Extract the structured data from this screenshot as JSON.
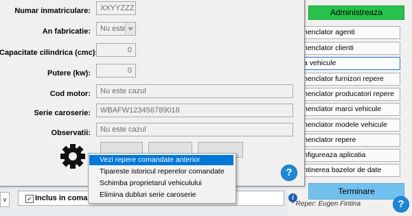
{
  "menu": {
    "header": "Administreaza",
    "items": [
      {
        "label": "nenclator agenti",
        "selected": false
      },
      {
        "label": "nenclator clienti",
        "selected": false
      },
      {
        "label": "a vehicule",
        "selected": true
      },
      {
        "label": "nenclator furnizori repere",
        "selected": false
      },
      {
        "label": "nenclator producatori repere",
        "selected": false
      },
      {
        "label": "nenclator marci vehicule",
        "selected": false
      },
      {
        "label": "nenclator modele vehicule",
        "selected": false
      },
      {
        "label": "nenclator repere",
        "selected": false
      },
      {
        "label": "nfigureaza aplicatia",
        "selected": false
      },
      {
        "label": "ntinerea bazelor de date",
        "selected": false
      }
    ],
    "terminate": "Terminare",
    "credit": "* Reper: Eugen Fintina",
    "colors": {
      "header": "#27c24c",
      "terminate": "#71c1ef",
      "selected_border": "#2a73c7"
    }
  },
  "form": {
    "fields": [
      {
        "label": "Numar inmatriculare:",
        "value": "XXYYZZZ"
      },
      {
        "label": "An fabricatie:",
        "value": "Nu este"
      },
      {
        "label": "Capacitate cilindrica (cmc):",
        "value": "0"
      },
      {
        "label": "Putere (kw):",
        "value": "0"
      },
      {
        "label": "Cod motor:",
        "value": "Nu este cazul"
      },
      {
        "label": "Serie caroserie:",
        "value": "WBAFW123456789018"
      },
      {
        "label": "Observatii:",
        "value": "Nu este cazul"
      }
    ],
    "help_glyph": "?",
    "gear_icon": "gear-icon"
  },
  "bottom": {
    "left_glyph": "v",
    "checkbox_checked": "✓",
    "checkbox_label": "Inclus in comanda",
    "info_glyph": "i",
    "help_glyph": "?"
  },
  "context_menu": {
    "items": [
      {
        "label": "Vezi repere comandate anterior",
        "highlighted": true
      },
      {
        "label": "Tipareste istoricul reperelor comandate",
        "highlighted": false
      },
      {
        "label": "Schimba proprietarul vehiculului",
        "highlighted": false
      },
      {
        "label": "Elimina dubluri serie caroserie",
        "highlighted": false
      }
    ],
    "highlight_color": "#0078d7"
  }
}
